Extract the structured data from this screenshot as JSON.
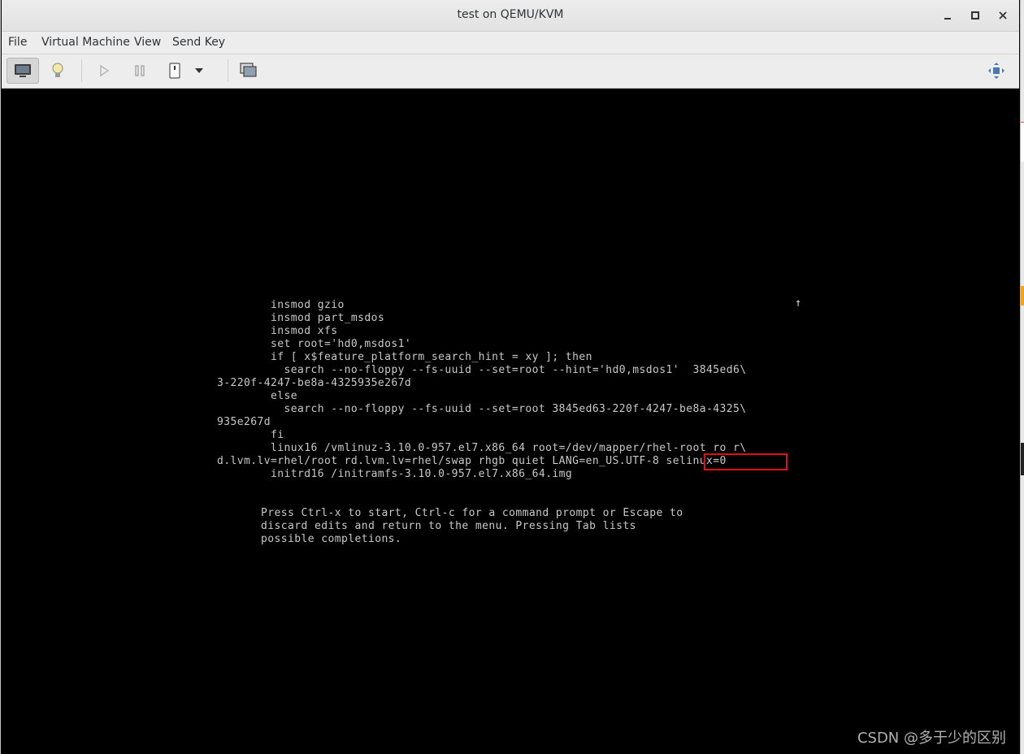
{
  "window": {
    "title": "test on QEMU/KVM",
    "controls": [
      "minimize",
      "maximize",
      "close"
    ]
  },
  "menubar": {
    "items": [
      "File",
      "Virtual Machine",
      "View",
      "Send Key"
    ]
  },
  "toolbar": {
    "buttons": [
      "console-icon",
      "details-bulb-icon",
      "run-icon",
      "pause-icon",
      "shutdown-icon",
      "dropdown-arrow-icon",
      "snapshots-icon",
      "fullscreen-icon"
    ]
  },
  "console": {
    "lines": [
      "        insmod gzio",
      "        insmod part_msdos",
      "        insmod xfs",
      "        set root='hd0,msdos1'",
      "        if [ x$feature_platform_search_hint = xy ]; then",
      "          search --no-floppy --fs-uuid --set=root --hint='hd0,msdos1'  3845ed6\\",
      "3-220f-4247-be8a-4325935e267d",
      "        else",
      "          search --no-floppy --fs-uuid --set=root 3845ed63-220f-4247-be8a-4325\\",
      "935e267d",
      "        fi",
      "        linux16 /vmlinuz-3.10.0-957.el7.x86_64 root=/dev/mapper/rhel-root ro r\\",
      "d.lvm.lv=rhel/root rd.lvm.lv=rhel/swap rhgb quiet LANG=en_US.UTF-8 selinux=0",
      "        initrd16 /initramfs-3.10.0-957.el7.x86_64.img"
    ],
    "help_lines": [
      "Press Ctrl-x to start, Ctrl-c for a command prompt or Escape to",
      "discard edits and return to the menu. Pressing Tab lists",
      "possible completions."
    ],
    "scroll_indicator": "↑",
    "highlighted_text": "selinux=0",
    "highlight_color": "#e01010"
  },
  "watermark": "CSDN @多于少的区别"
}
